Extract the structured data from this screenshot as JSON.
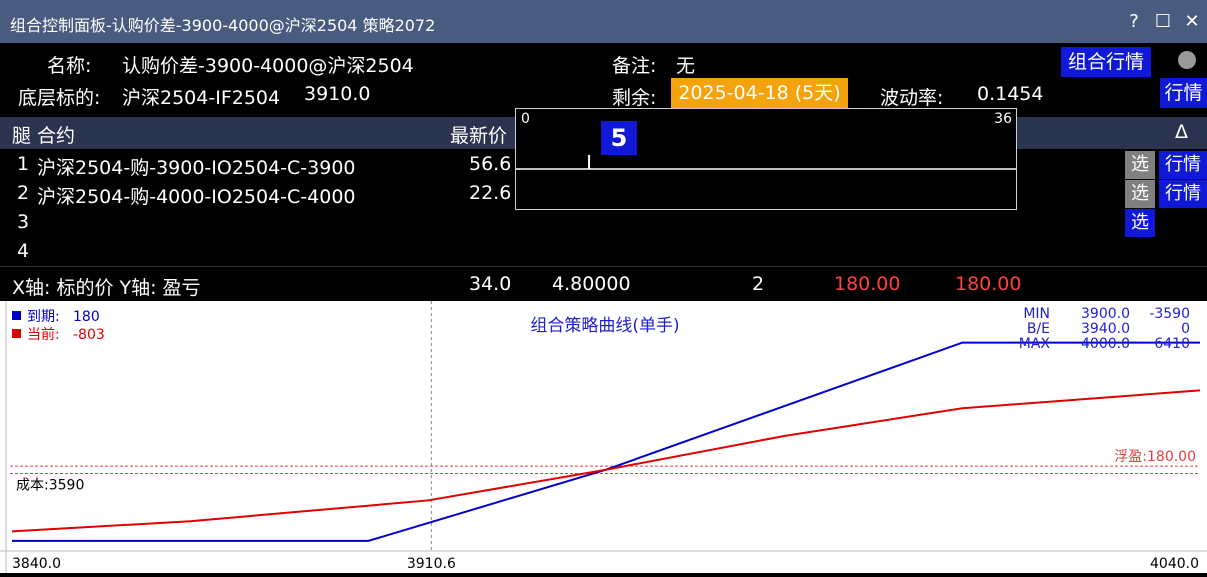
{
  "window": {
    "title": "组合控制面板-认购价差-3900-4000@沪深2504 策略2072",
    "help_label": "?",
    "maximize_label": "☐",
    "close_label": "✕"
  },
  "info": {
    "name_label": "名称:",
    "name_value": "认购价差-3900-4000@沪深2504",
    "underlying_label": "底层标的:",
    "underlying_value": "沪深2504-IF2504",
    "underlying_price": "3910.0",
    "note_label": "备注:",
    "note_value": "无",
    "remaining_label": "剩余:",
    "remaining_value": "2025-04-18 (5天)",
    "vol_label": "波动率:",
    "vol_value": "0.1454",
    "combo_quote_button": "组合行情",
    "quote_button": "行情"
  },
  "table": {
    "headers": [
      "腿 合约",
      "最新价",
      "Δ"
    ],
    "rows": [
      {
        "leg": "1",
        "contract": "沪深2504-购-3900-IO2504-C-3900",
        "last": "56.6",
        "select": "选",
        "quote": "行情"
      },
      {
        "leg": "2",
        "contract": "沪深2504-购-4000-IO2504-C-4000",
        "last": "22.6",
        "select": "选",
        "quote": "行情"
      },
      {
        "leg": "3",
        "contract": "",
        "last": "",
        "select": "选",
        "quote": ""
      },
      {
        "leg": "4",
        "contract": "",
        "last": "",
        "select": "",
        "quote": ""
      }
    ]
  },
  "summary": {
    "axis_label": "X轴: 标的价   Y轴: 盈亏",
    "v1": "34.0",
    "v2": "4.80000",
    "v3": "2",
    "v4": "180.00",
    "v5": "180.00"
  },
  "popup": {
    "min_label": "0",
    "max_label": "36",
    "value": "5"
  },
  "chart_data": {
    "type": "line",
    "title": "组合策略曲线(单手)",
    "xlabel": "",
    "ylabel": "",
    "xlim": [
      3840.0,
      4040.0
    ],
    "ylim": [
      -4100,
      7500
    ],
    "x_ticks": [
      "3840.0",
      "3910.6",
      "4040.0"
    ],
    "cursor_x": 3910.6,
    "legend": [
      {
        "label": "到期:",
        "value": "180",
        "color": "#0000cc"
      },
      {
        "label": "当前:",
        "value": "-803",
        "color": "#e00000"
      }
    ],
    "stats": {
      "rows": [
        {
          "label": "MIN",
          "x": "3900.0",
          "y": "-3590"
        },
        {
          "label": "B/E",
          "x": "3940.0",
          "y": "0"
        },
        {
          "label": "MAX",
          "x": "4000.0",
          "y": "6410"
        }
      ]
    },
    "cost_label": "成本:3590",
    "cost_value": -190,
    "float_label": "浮盈:180.00",
    "float_value": 180,
    "series": [
      {
        "name": "到期",
        "color": "#0000cc",
        "x": [
          3840,
          3900,
          3940,
          4000,
          4040
        ],
        "y": [
          -3590,
          -3590,
          0,
          6410,
          6410
        ]
      },
      {
        "name": "当前",
        "color": "#e00000",
        "x": [
          3840,
          3870,
          3910,
          3940,
          3970,
          4000,
          4040
        ],
        "y": [
          -3110,
          -2600,
          -1550,
          0,
          1700,
          3100,
          4000
        ]
      }
    ]
  }
}
